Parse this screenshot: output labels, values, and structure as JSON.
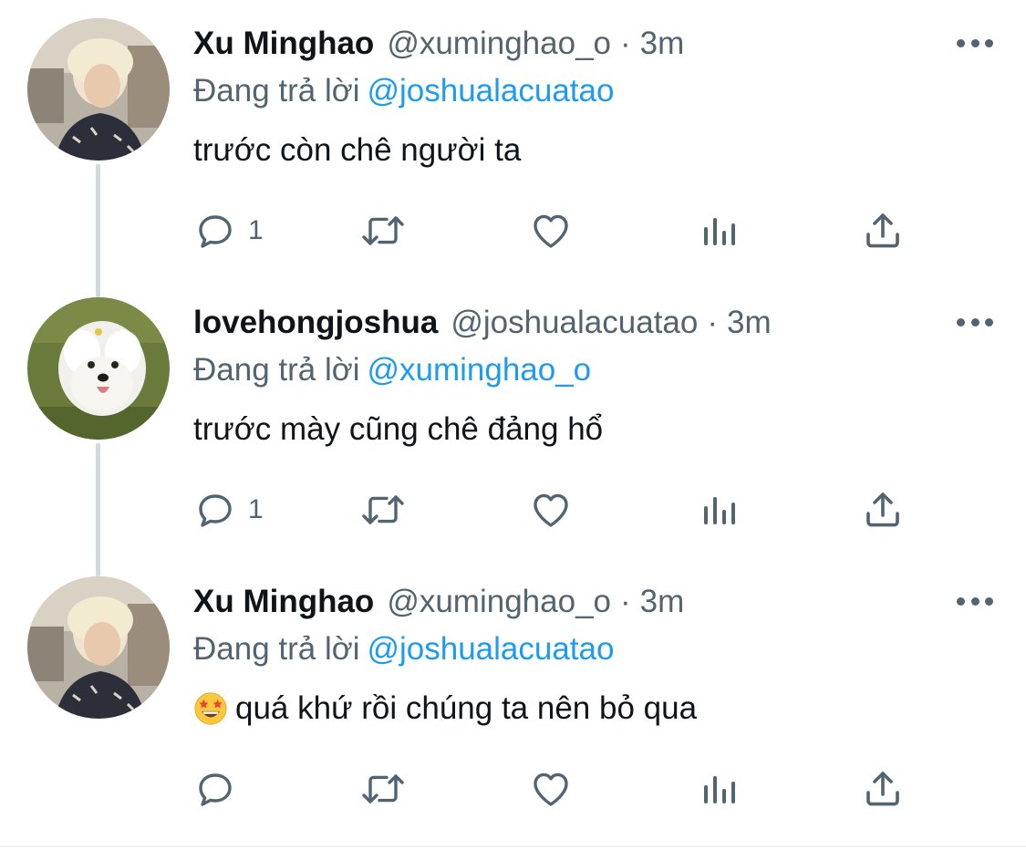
{
  "tweets": [
    {
      "name": "Xu Minghao",
      "handle": "@xuminghao_o",
      "separator": "·",
      "time": "3m",
      "reply_prefix": "Đang trả lời",
      "reply_to": "@joshualacuatao",
      "text": "trước còn chê người ta",
      "emoji": "",
      "reply_count": "1",
      "avatar": "blond-person-photo"
    },
    {
      "name": "lovehongjoshua",
      "handle": "@joshualacuatao",
      "separator": "·",
      "time": "3m",
      "reply_prefix": "Đang trả lời",
      "reply_to": "@xuminghao_o",
      "text": "trước mày cũng chê đảng hổ",
      "emoji": "",
      "reply_count": "1",
      "avatar": "white-dog-photo"
    },
    {
      "name": "Xu Minghao",
      "handle": "@xuminghao_o",
      "separator": "·",
      "time": "3m",
      "reply_prefix": "Đang trả lời",
      "reply_to": "@joshualacuatao",
      "text": "quá khứ rồi chúng ta nên bỏ qua",
      "emoji": "star-struck-emoji",
      "reply_count": "",
      "avatar": "blond-person-photo"
    }
  ],
  "icons": {
    "reply": "reply-icon",
    "retweet": "retweet-icon",
    "like": "heart-icon",
    "views": "bar-chart-icon",
    "share": "share-icon",
    "more": "more-icon"
  },
  "colors": {
    "text": "#0f1419",
    "secondary": "#536471",
    "link": "#1d9bf0",
    "thread_line": "#cfd9de"
  }
}
